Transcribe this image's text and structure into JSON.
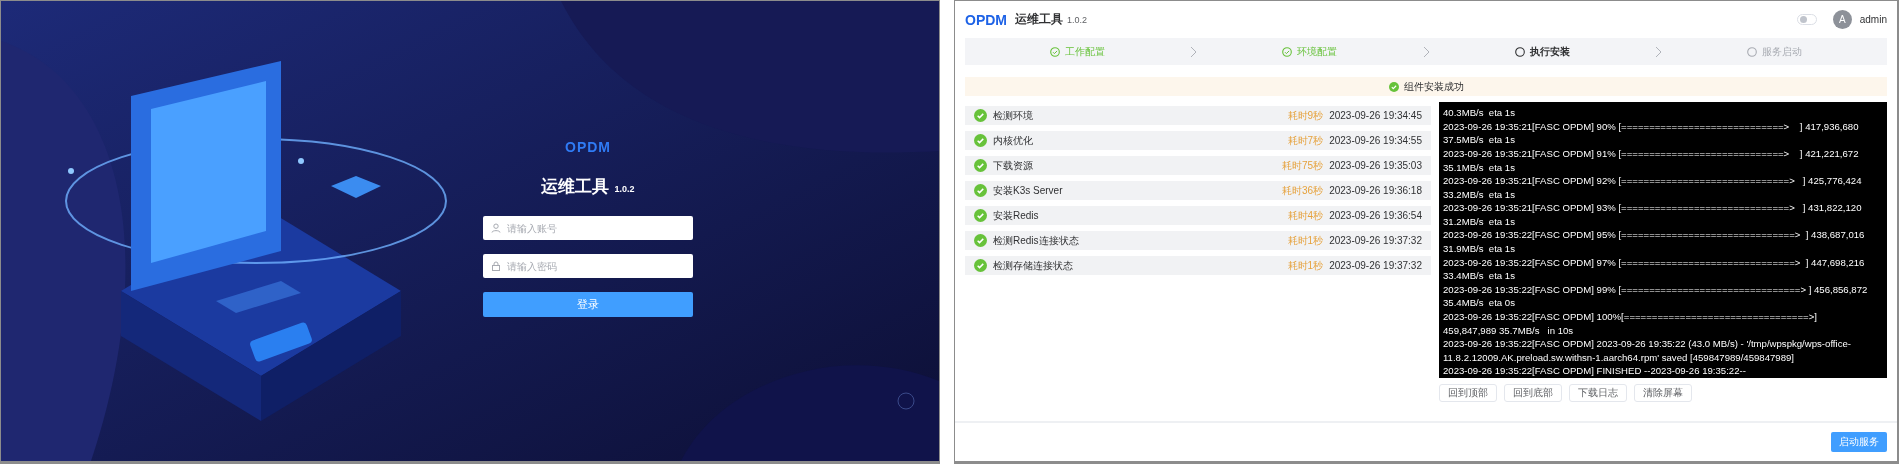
{
  "login": {
    "logo": "OPDM",
    "title": "运维工具",
    "version": "1.0.2",
    "fields": [
      {
        "kind": "user",
        "placeholder": "请输入账号"
      },
      {
        "kind": "lock",
        "placeholder": "请输入密码"
      }
    ],
    "login_button": "登录"
  },
  "app": {
    "header": {
      "logo": "OPDM",
      "title": "运维工具",
      "version": "1.0.2",
      "theme_toggle": {
        "on": false
      },
      "avatar": "A",
      "user": "admin"
    },
    "steps": [
      {
        "label": "工作配置",
        "completed": true,
        "selected": false
      },
      {
        "label": "环境配置",
        "completed": true,
        "selected": false
      },
      {
        "label": "执行安装",
        "completed": false,
        "selected": true
      },
      {
        "label": "服务启动",
        "completed": false,
        "selected": false
      }
    ],
    "alert": {
      "text": "组件安装成功",
      "success": true
    },
    "tasks": [
      {
        "name": "检测环境",
        "duration": "耗时9秒",
        "time": "2023-09-26 19:34:45",
        "done": true
      },
      {
        "name": "内核优化",
        "duration": "耗时7秒",
        "time": "2023-09-26 19:34:55",
        "done": true
      },
      {
        "name": "下载资源",
        "duration": "耗时75秒",
        "time": "2023-09-26 19:35:03",
        "done": true
      },
      {
        "name": "安装K3s Server",
        "duration": "耗时36秒",
        "time": "2023-09-26 19:36:18",
        "done": true
      },
      {
        "name": "安装Redis",
        "duration": "耗时4秒",
        "time": "2023-09-26 19:36:54",
        "done": true
      },
      {
        "name": "检测Redis连接状态",
        "duration": "耗时1秒",
        "time": "2023-09-26 19:37:32",
        "done": true
      },
      {
        "name": "检测存储连接状态",
        "duration": "耗时1秒",
        "time": "2023-09-26 19:37:32",
        "done": true
      }
    ],
    "log": {
      "lines": [
        "40.3MB/s  eta 1s",
        "2023-09-26 19:35:21[FASC OPDM] 90% [=============================>    ] 417,936,680",
        "37.5MB/s  eta 1s",
        "2023-09-26 19:35:21[FASC OPDM] 91% [=============================>    ] 421,221,672",
        "35.1MB/s  eta 1s",
        "2023-09-26 19:35:21[FASC OPDM] 92% [==============================>   ] 425,776,424",
        "33.2MB/s  eta 1s",
        "2023-09-26 19:35:21[FASC OPDM] 93% [==============================>   ] 431,822,120",
        "31.2MB/s  eta 1s",
        "2023-09-26 19:35:22[FASC OPDM] 95% [===============================>  ] 438,687,016",
        "31.9MB/s  eta 1s",
        "2023-09-26 19:35:22[FASC OPDM] 97% [===============================>  ] 447,698,216",
        "33.4MB/s  eta 1s",
        "2023-09-26 19:35:22[FASC OPDM] 99% [================================> ] 456,856,872",
        "35.4MB/s  eta 0s",
        "2023-09-26 19:35:22[FASC OPDM] 100%[=================================>]",
        "459,847,989 35.7MB/s   in 10s",
        "2023-09-26 19:35:22[FASC OPDM] 2023-09-26 19:35:22 (43.0 MB/s) - '/tmp/wpspkg/wps-office-",
        "11.8.2.12009.AK.preload.sw.withsn-1.aarch64.rpm' saved [459847989/459847989]",
        "2023-09-26 19:35:22[FASC OPDM] FINISHED --2023-09-26 19:35:22--"
      ]
    },
    "log_buttons": [
      "回到顶部",
      "回到底部",
      "下载日志",
      "清除屏幕"
    ],
    "start_button": "启动服务"
  }
}
